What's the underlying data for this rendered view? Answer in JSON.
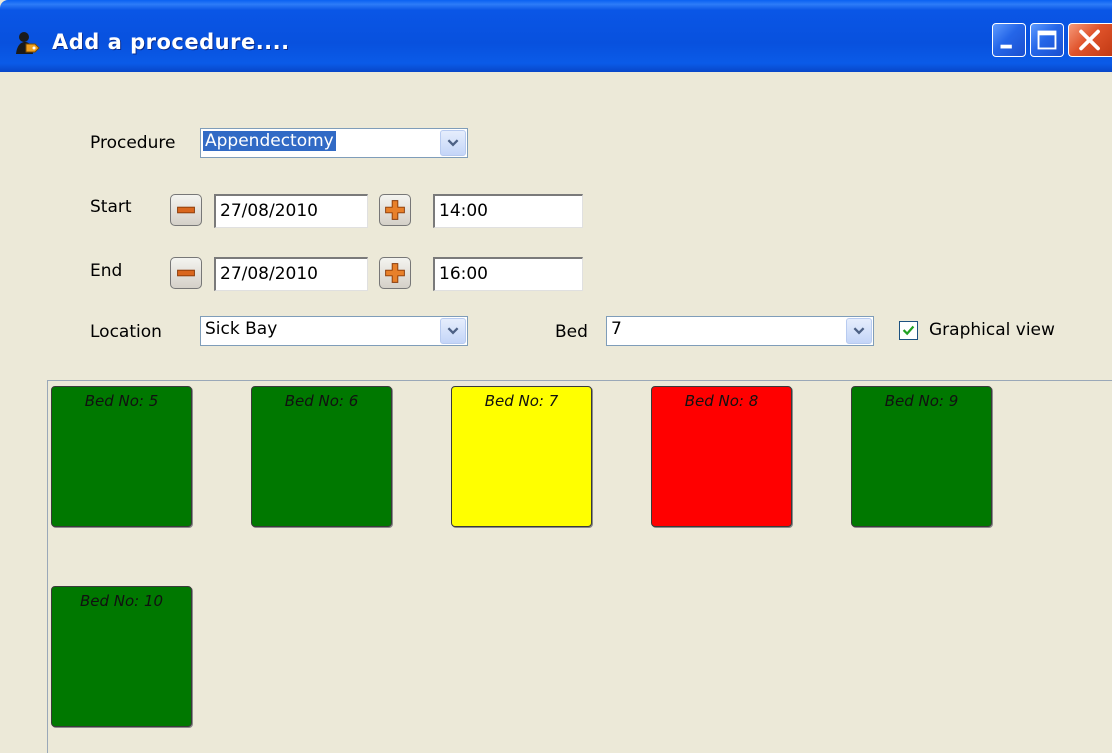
{
  "window": {
    "title": "Add a procedure....",
    "title_color": "#0a56e6"
  },
  "procedure": {
    "label": "Procedure",
    "value": "Appendectomy"
  },
  "start": {
    "label": "Start",
    "date": "27/08/2010",
    "time": "14:00"
  },
  "end": {
    "label": "End",
    "date": "27/08/2010",
    "time": "16:00"
  },
  "location": {
    "label": "Location",
    "value": "Sick Bay"
  },
  "bed": {
    "label": "Bed",
    "value": "7"
  },
  "graphical_view": {
    "label": "Graphical view",
    "checked": true
  },
  "beds": [
    {
      "label": "Bed No: 5",
      "status_color": "#007800"
    },
    {
      "label": "Bed No: 6",
      "status_color": "#007800"
    },
    {
      "label": "Bed No: 7",
      "status_color": "#ffff00"
    },
    {
      "label": "Bed No: 8",
      "status_color": "#ff0000"
    },
    {
      "label": "Bed No: 9",
      "status_color": "#007800"
    },
    {
      "label": "Bed No: 10",
      "status_color": "#007800"
    }
  ],
  "icons": {
    "minus": "minus-icon",
    "plus": "plus-icon",
    "dropdown": "chevron-down-icon",
    "check": "checkmark-icon"
  }
}
